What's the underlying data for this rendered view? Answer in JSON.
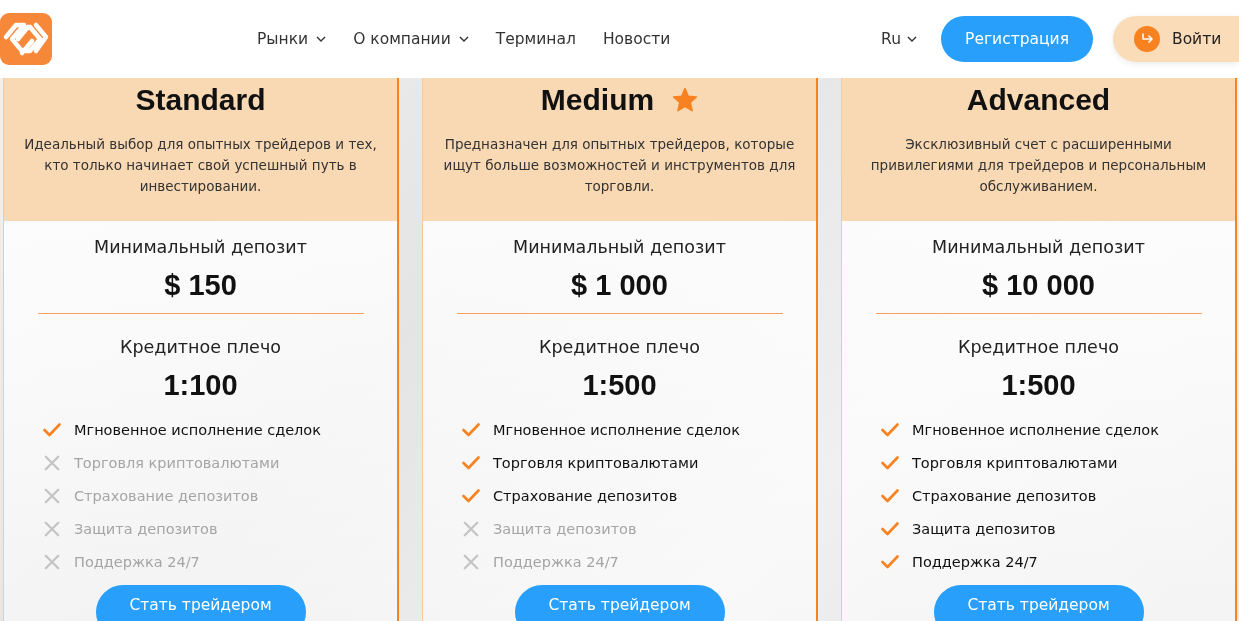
{
  "header": {
    "nav": [
      {
        "label": "Рынки",
        "dropdown": true
      },
      {
        "label": "О компании",
        "dropdown": true
      },
      {
        "label": "Терминал",
        "dropdown": false
      },
      {
        "label": "Новости",
        "dropdown": false
      }
    ],
    "language": "Ru",
    "register_button": "Регистрация",
    "login_button": "Войти"
  },
  "plans": [
    {
      "name": "Standard",
      "featured": false,
      "description": "Идеальный выбор для опытных трейдеров и тех, кто только начинает свой успешный путь в инвестировании.",
      "deposit_label": "Минимальный депозит",
      "deposit": "$ 150",
      "leverage_label": "Кредитное плечо",
      "leverage": "1:100",
      "features": [
        {
          "label": "Мгновенное исполнение сделок",
          "included": true
        },
        {
          "label": "Торговля криптовалютами",
          "included": false
        },
        {
          "label": "Страхование депозитов",
          "included": false
        },
        {
          "label": "Защита депозитов",
          "included": false
        },
        {
          "label": "Поддержка 24/7",
          "included": false
        }
      ],
      "button": "Стать трейдером"
    },
    {
      "name": "Medium",
      "featured": true,
      "description": "Предназначен для опытных трейдеров, которые ищут больше возможностей и инструментов для торговли.",
      "deposit_label": "Минимальный депозит",
      "deposit": "$ 1 000",
      "leverage_label": "Кредитное плечо",
      "leverage": "1:500",
      "features": [
        {
          "label": "Мгновенное исполнение сделок",
          "included": true
        },
        {
          "label": "Торговля криптовалютами",
          "included": true
        },
        {
          "label": "Страхование депозитов",
          "included": true
        },
        {
          "label": "Защита депозитов",
          "included": false
        },
        {
          "label": "Поддержка 24/7",
          "included": false
        }
      ],
      "button": "Стать трейдером"
    },
    {
      "name": "Advanced",
      "featured": false,
      "description": "Эксклюзивный счет с расширенными привилегиями для трейдеров и персональным обслуживанием.",
      "deposit_label": "Минимальный депозит",
      "deposit": "$ 10 000",
      "leverage_label": "Кредитное плечо",
      "leverage": "1:500",
      "features": [
        {
          "label": "Мгновенное исполнение сделок",
          "included": true
        },
        {
          "label": "Торговля криптовалютами",
          "included": true
        },
        {
          "label": "Страхование депозитов",
          "included": true
        },
        {
          "label": "Защита депозитов",
          "included": true
        },
        {
          "label": "Поддержка 24/7",
          "included": true
        }
      ],
      "button": "Стать трейдером"
    }
  ]
}
